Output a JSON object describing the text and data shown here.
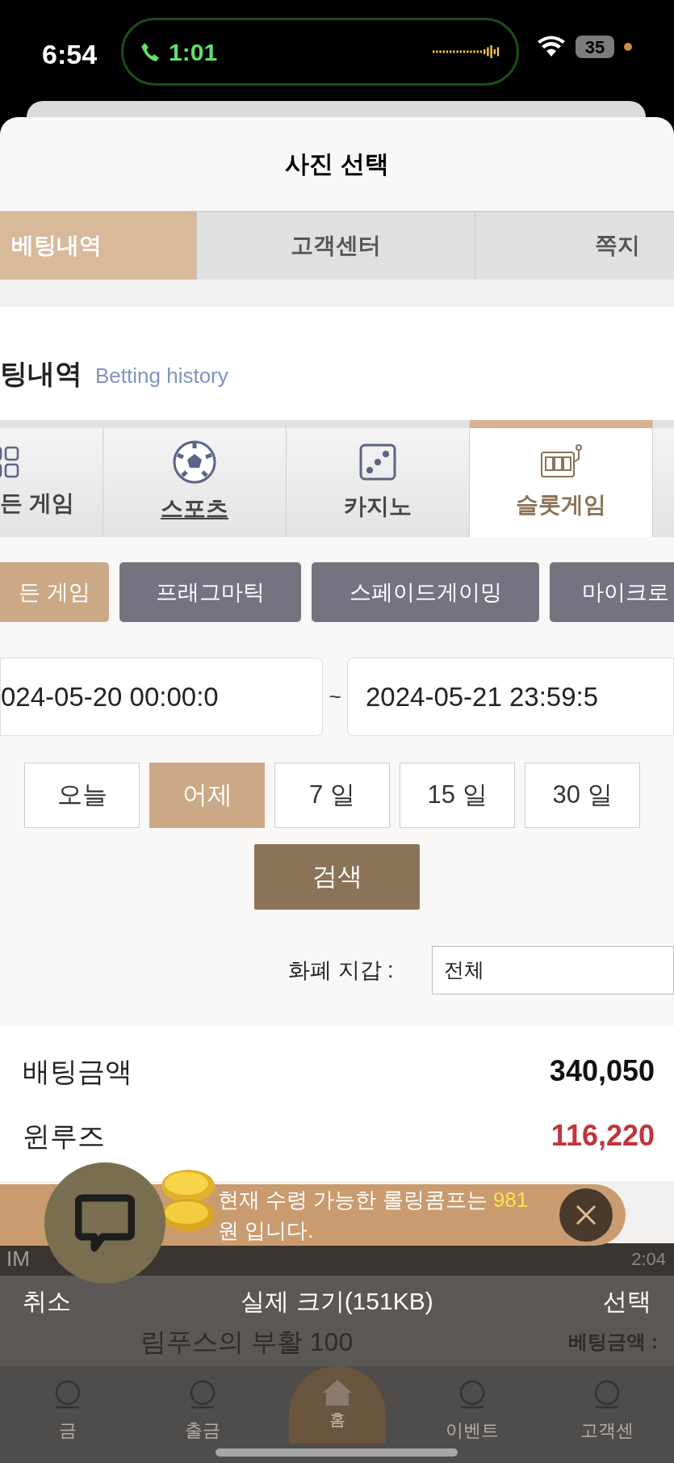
{
  "status_bar": {
    "time": "6:54",
    "call_duration": "1:01",
    "battery": "35"
  },
  "sheet": {
    "title": "사진 선택"
  },
  "top_tabs": [
    {
      "label": "베팅내역",
      "selected": true
    },
    {
      "label": "고객센터",
      "selected": false
    },
    {
      "label": "쪽지",
      "selected": false
    }
  ],
  "heading": {
    "title": "팅내역",
    "subtitle": "Betting history"
  },
  "game_tabs": [
    {
      "label": "든 게임",
      "kind": "grid",
      "selected": false
    },
    {
      "label": "스포츠",
      "kind": "ball",
      "selected": false
    },
    {
      "label": "카지노",
      "kind": "dice",
      "selected": false
    },
    {
      "label": "슬롯게임",
      "kind": "slot",
      "selected": true
    }
  ],
  "providers": [
    {
      "label": "든 게임",
      "selected": true
    },
    {
      "label": "프래그마틱",
      "selected": false
    },
    {
      "label": "스페이드게이밍",
      "selected": false
    },
    {
      "label": "마이크로",
      "selected": false
    }
  ],
  "date_range": {
    "start": "024-05-20 00:00:0",
    "separator": "~",
    "end": "2024-05-21 23:59:5"
  },
  "periods": [
    {
      "label": "오늘",
      "selected": false
    },
    {
      "label": "어제",
      "selected": true
    },
    {
      "label": "7 일",
      "selected": false
    },
    {
      "label": "15 일",
      "selected": false
    },
    {
      "label": "30 일",
      "selected": false
    }
  ],
  "search_button": "검색",
  "wallet": {
    "label": "화폐 지갑 :",
    "value": "전체"
  },
  "summary": [
    {
      "label": "배팅금액",
      "value": "340,050",
      "kind": "neutral"
    },
    {
      "label": "윈루즈",
      "value": "116,220",
      "kind": "negative"
    }
  ],
  "banner": {
    "text_before": "현재 수령 가능한 롤링콤프는",
    "amount": "981",
    "text_after": "원 입니다."
  },
  "behind_row": {
    "provider": "IM",
    "time": "2:04"
  },
  "photo_bar": {
    "cancel": "취소",
    "size": "실제 크기(151KB)",
    "choose": "선택"
  },
  "dimmed": {
    "game_title": "림푸스의 부활 100",
    "bet_label": "베팅금액 :",
    "nav": [
      "금",
      "출금",
      "홈",
      "이벤트",
      "고객센"
    ]
  }
}
